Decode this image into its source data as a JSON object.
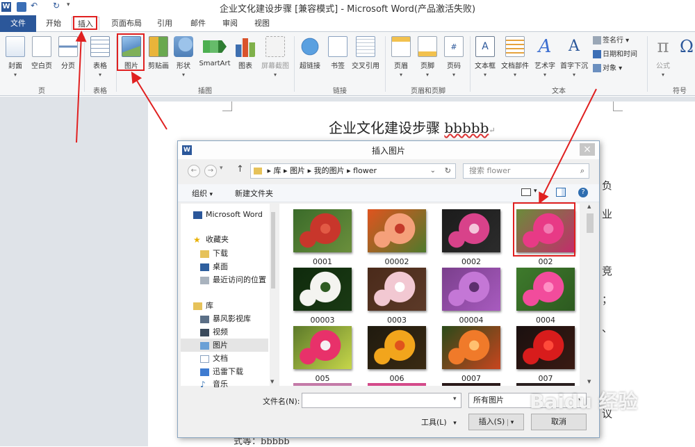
{
  "window": {
    "title": "企业文化建设步骤 [兼容模式] - Microsoft Word(产品激活失败)"
  },
  "tabs": [
    "文件",
    "开始",
    "插入",
    "页面布局",
    "引用",
    "邮件",
    "审阅",
    "视图"
  ],
  "ribbon": {
    "page_group": {
      "label": "页",
      "buttons": [
        "封面",
        "空白页",
        "分页"
      ]
    },
    "table_group": {
      "label": "表格",
      "buttons": [
        "表格"
      ]
    },
    "illus_group": {
      "label": "插图",
      "buttons": [
        "图片",
        "剪贴画",
        "形状",
        "SmartArt",
        "图表",
        "屏幕截图"
      ]
    },
    "link_group": {
      "label": "链接",
      "buttons": [
        "超链接",
        "书签",
        "交叉引用"
      ]
    },
    "hf_group": {
      "label": "页眉和页脚",
      "buttons": [
        "页眉",
        "页脚",
        "页码"
      ]
    },
    "text_group": {
      "label": "文本",
      "buttons": [
        "文本框",
        "文档部件",
        "艺术字",
        "首字下沉"
      ],
      "small": [
        "签名行",
        "日期和时间",
        "对象"
      ]
    },
    "symbol_group": {
      "label": "符号",
      "buttons": [
        "公式"
      ]
    }
  },
  "document": {
    "title_prefix": "企业文化建设步骤 ",
    "title_word": "bbbbb",
    "fragments": [
      "负",
      "业",
      "竞",
      "；",
      "、",
      "议"
    ],
    "bottom_line": "式等：bbbbb"
  },
  "dialog": {
    "title": "插入图片",
    "breadcrumb": [
      "库",
      "图片",
      "我的图片",
      "flower"
    ],
    "search_placeholder": "搜索 flower",
    "organize": "组织",
    "new_folder": "新建文件夹",
    "nav": {
      "top": "Microsoft Word",
      "favorites": "收藏夹",
      "fav_items": [
        "下载",
        "桌面",
        "最近访问的位置"
      ],
      "libraries": "库",
      "lib_items": [
        "暴风影视库",
        "视频",
        "图片",
        "文档",
        "迅雷下载",
        "音乐"
      ]
    },
    "files": [
      {
        "name": "0001",
        "palette": [
          "#3a6b2a",
          "#c8362b",
          "#e25a45",
          "#6b8f3c"
        ]
      },
      {
        "name": "00002",
        "palette": [
          "#e0541f",
          "#f5a07a",
          "#c43a2a",
          "#4f7a2c"
        ]
      },
      {
        "name": "0002",
        "palette": [
          "#1b1b1b",
          "#d8428a",
          "#f4c6da",
          "#2c2c2c"
        ]
      },
      {
        "name": "002",
        "palette": [
          "#6a8c3a",
          "#e83a86",
          "#f27bb2",
          "#c42c6c"
        ]
      },
      {
        "name": "00003",
        "palette": [
          "#0f2a0c",
          "#f4f4f0",
          "#2e5b22",
          "#1a3a14"
        ]
      },
      {
        "name": "0003",
        "palette": [
          "#4a2a1a",
          "#f2c8d2",
          "#ffffff",
          "#5c3a28"
        ]
      },
      {
        "name": "00004",
        "palette": [
          "#7a3f8c",
          "#c477d6",
          "#5d2f6e",
          "#a85bbf"
        ]
      },
      {
        "name": "0004",
        "palette": [
          "#3e7a2c",
          "#f24c9c",
          "#ff8fc4",
          "#2d5a20"
        ]
      },
      {
        "name": "005",
        "palette": [
          "#5c7a2a",
          "#e8316a",
          "#f5f0f2",
          "#c6d64a"
        ]
      },
      {
        "name": "006",
        "palette": [
          "#1f1a0f",
          "#f2a51c",
          "#e0531c",
          "#3a2a12"
        ]
      },
      {
        "name": "0007",
        "palette": [
          "#2a4a1a",
          "#f07a2a",
          "#ffc070",
          "#c8451e"
        ]
      },
      {
        "name": "007",
        "palette": [
          "#1a1010",
          "#d81c1c",
          "#ff4a3a",
          "#3a1a12"
        ]
      }
    ],
    "filename_label": "文件名(N):",
    "filename_value": "",
    "filetype": "所有图片",
    "tools": "工具(L)",
    "insert": "插入(S)",
    "cancel": "取消"
  },
  "watermark": "Baidu 经验"
}
